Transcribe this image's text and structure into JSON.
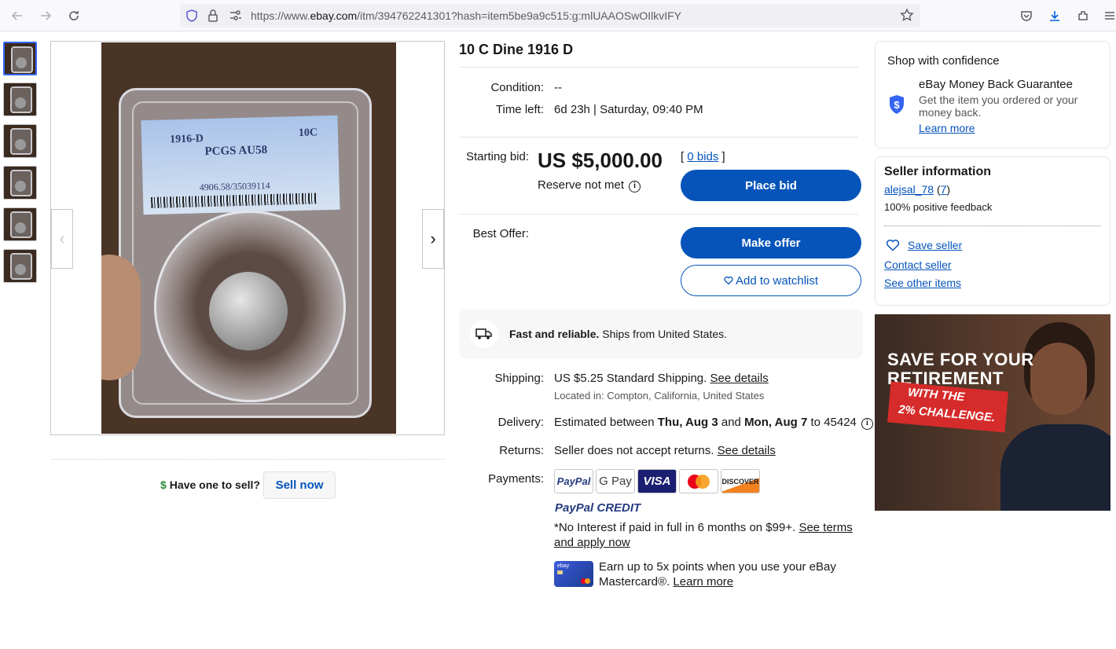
{
  "browser": {
    "url_prefix": "https://www.",
    "url_domain": "ebay.com",
    "url_suffix": "/itm/394762241301?hash=item5be9a9c515:g:mlUAAOSwOIlkvIFY"
  },
  "gallery": {
    "slab_label": {
      "year": "1916-D",
      "denom": "10C",
      "grade": "PCGS AU58",
      "cert": "4906.58/35039114"
    },
    "prev_arrow": "‹",
    "next_arrow": "›"
  },
  "sell": {
    "question": "Have one to sell?",
    "button": "Sell now"
  },
  "item": {
    "title": "10 C Dine 1916 D",
    "condition_label": "Condition:",
    "condition_value": "--",
    "time_left_label": "Time left:",
    "time_left_value": "6d 23h | Saturday, 09:40 PM",
    "starting_bid_label": "Starting bid:",
    "price": "US $5,000.00",
    "reserve": "Reserve not met",
    "bids_open": "[",
    "bids_link": "0 bids",
    "bids_close": "]",
    "place_bid": "Place bid",
    "best_offer_label": "Best Offer:",
    "make_offer": "Make offer",
    "watchlist": "Add to watchlist"
  },
  "shipping_banner": {
    "bold": "Fast and reliable.",
    "text": "Ships from United States."
  },
  "details": {
    "shipping_label": "Shipping:",
    "shipping_price": "US $5.25",
    "shipping_method": "Standard Shipping.",
    "shipping_link": "See details",
    "location": "Located in: Compton, California, United States",
    "delivery_label": "Delivery:",
    "delivery_pre": "Estimated between",
    "delivery_from": "Thu, Aug 3",
    "delivery_and": "and",
    "delivery_to": "Mon, Aug 7",
    "delivery_zip": "to 45424",
    "returns_label": "Returns:",
    "returns_text": "Seller does not accept returns.",
    "returns_link": "See details",
    "payments_label": "Payments:",
    "payment_logos": [
      "PayPal",
      "G Pay",
      "VISA",
      "Mastercard",
      "DISCOVER"
    ],
    "ppcredit_a": "PayPal",
    "ppcredit_b": "CREDIT",
    "ppcredit_note": "*No Interest if paid in full in 6 months on $99+.",
    "ppcredit_link_a": "See terms",
    "ppcredit_link_b": "and apply now",
    "card_text_a": "Earn up to 5x points when you use your eBay",
    "card_text_b": "Mastercard®.",
    "card_link": "Learn more"
  },
  "confidence": {
    "heading": "Shop with confidence",
    "guarantee_title": "eBay Money Back Guarantee",
    "guarantee_text_a": "Get the item you ordered or your",
    "guarantee_text_b": "money back.",
    "learn_more": "Learn more"
  },
  "seller": {
    "heading": "Seller information",
    "name": "alejsal_78",
    "score_open": "(",
    "score": "7",
    "score_close": ")",
    "feedback": "100% positive feedback",
    "save": "Save seller",
    "contact": "Contact seller",
    "other_items": "See other items"
  },
  "ad": {
    "line1": "SAVE FOR YOUR",
    "line2": "RETIREMENT",
    "line3": "WITH THE",
    "line4": "2% CHALLENGE."
  },
  "colors": {
    "ebay_blue": "#0654ba",
    "link_blue": "#0654ba",
    "accent": "#3665f3"
  }
}
